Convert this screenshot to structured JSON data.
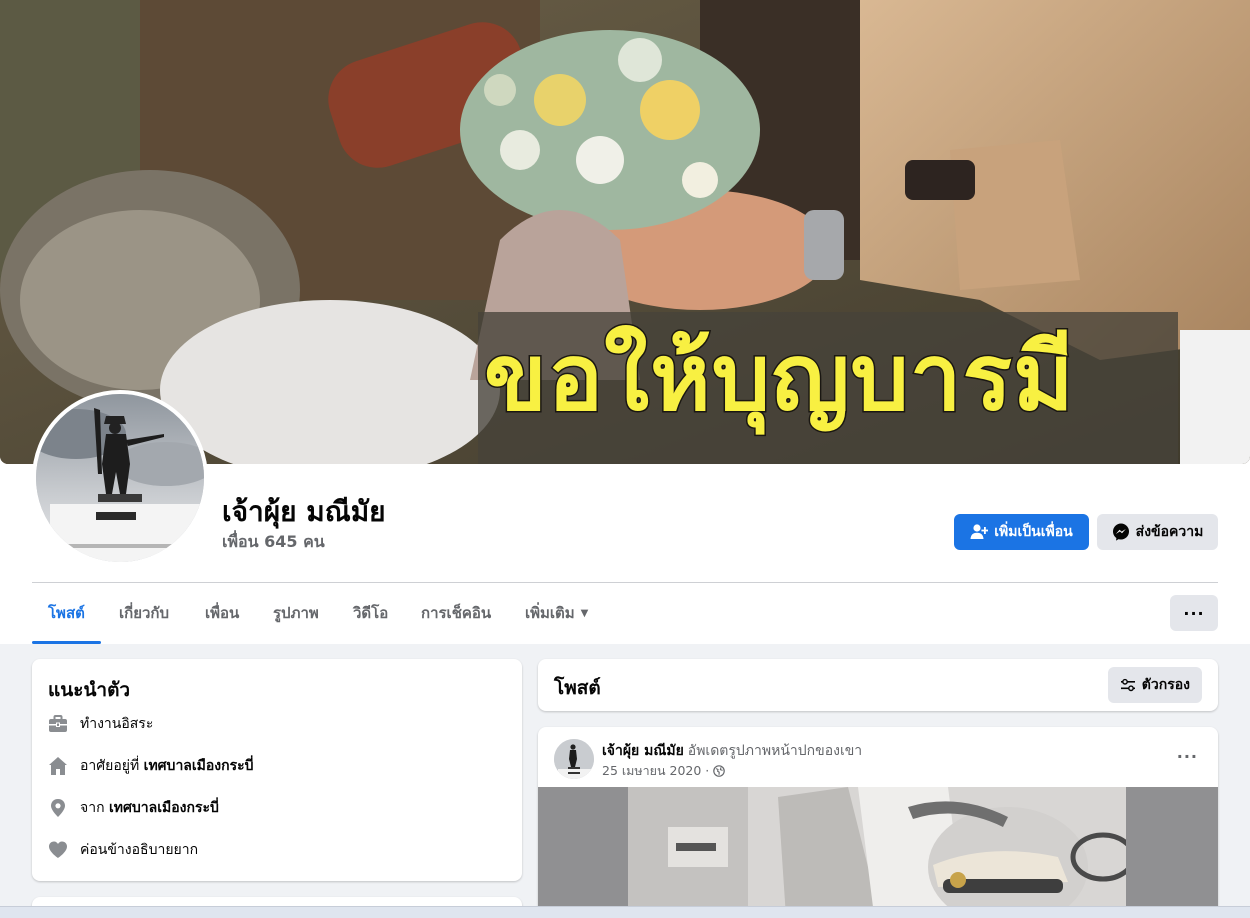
{
  "cover": {
    "caption": "ขอให้บุญบารมี"
  },
  "profile": {
    "name": "เจ้าผุ้ย มณีมัย",
    "friends": "เพื่อน 645 คน"
  },
  "actions": {
    "add_friend": "เพิ่มเป็นเพื่อน",
    "message": "ส่งข้อความ"
  },
  "tabs": [
    {
      "label": "โพสต์",
      "active": true
    },
    {
      "label": "เกี่ยวกับ"
    },
    {
      "label": "เพื่อน"
    },
    {
      "label": "รูปภาพ"
    },
    {
      "label": "วิดีโอ"
    },
    {
      "label": "การเช็คอิน"
    },
    {
      "label": "เพิ่มเติม"
    }
  ],
  "more_menu": "···",
  "intro": {
    "title": "แนะนำตัว",
    "items": [
      {
        "icon": "briefcase-icon",
        "text": "ทำงานอิสระ",
        "bold": ""
      },
      {
        "icon": "home-icon",
        "text": "อาศัยอยู่ที่ ",
        "bold": "เทศบาลเมืองกระบี่"
      },
      {
        "icon": "location-pin-icon",
        "text": "จาก ",
        "bold": "เทศบาลเมืองกระบี่"
      },
      {
        "icon": "heart-icon",
        "text": "ค่อนข้างอธิบายยาก",
        "bold": ""
      }
    ]
  },
  "posts": {
    "title": "โพสต์",
    "filter_label": "ตัวกรอง"
  },
  "post": {
    "author": "เจ้าผุ้ย มณีมัย",
    "action": "อัพเดตรูปภาพหน้าปกของเขา",
    "date": "25 เมษายน 2020 ·",
    "more": "···"
  },
  "colors": {
    "accent": "#1b74e4",
    "caption_yellow": "#f8f042",
    "secondary_text": "#65676b"
  }
}
